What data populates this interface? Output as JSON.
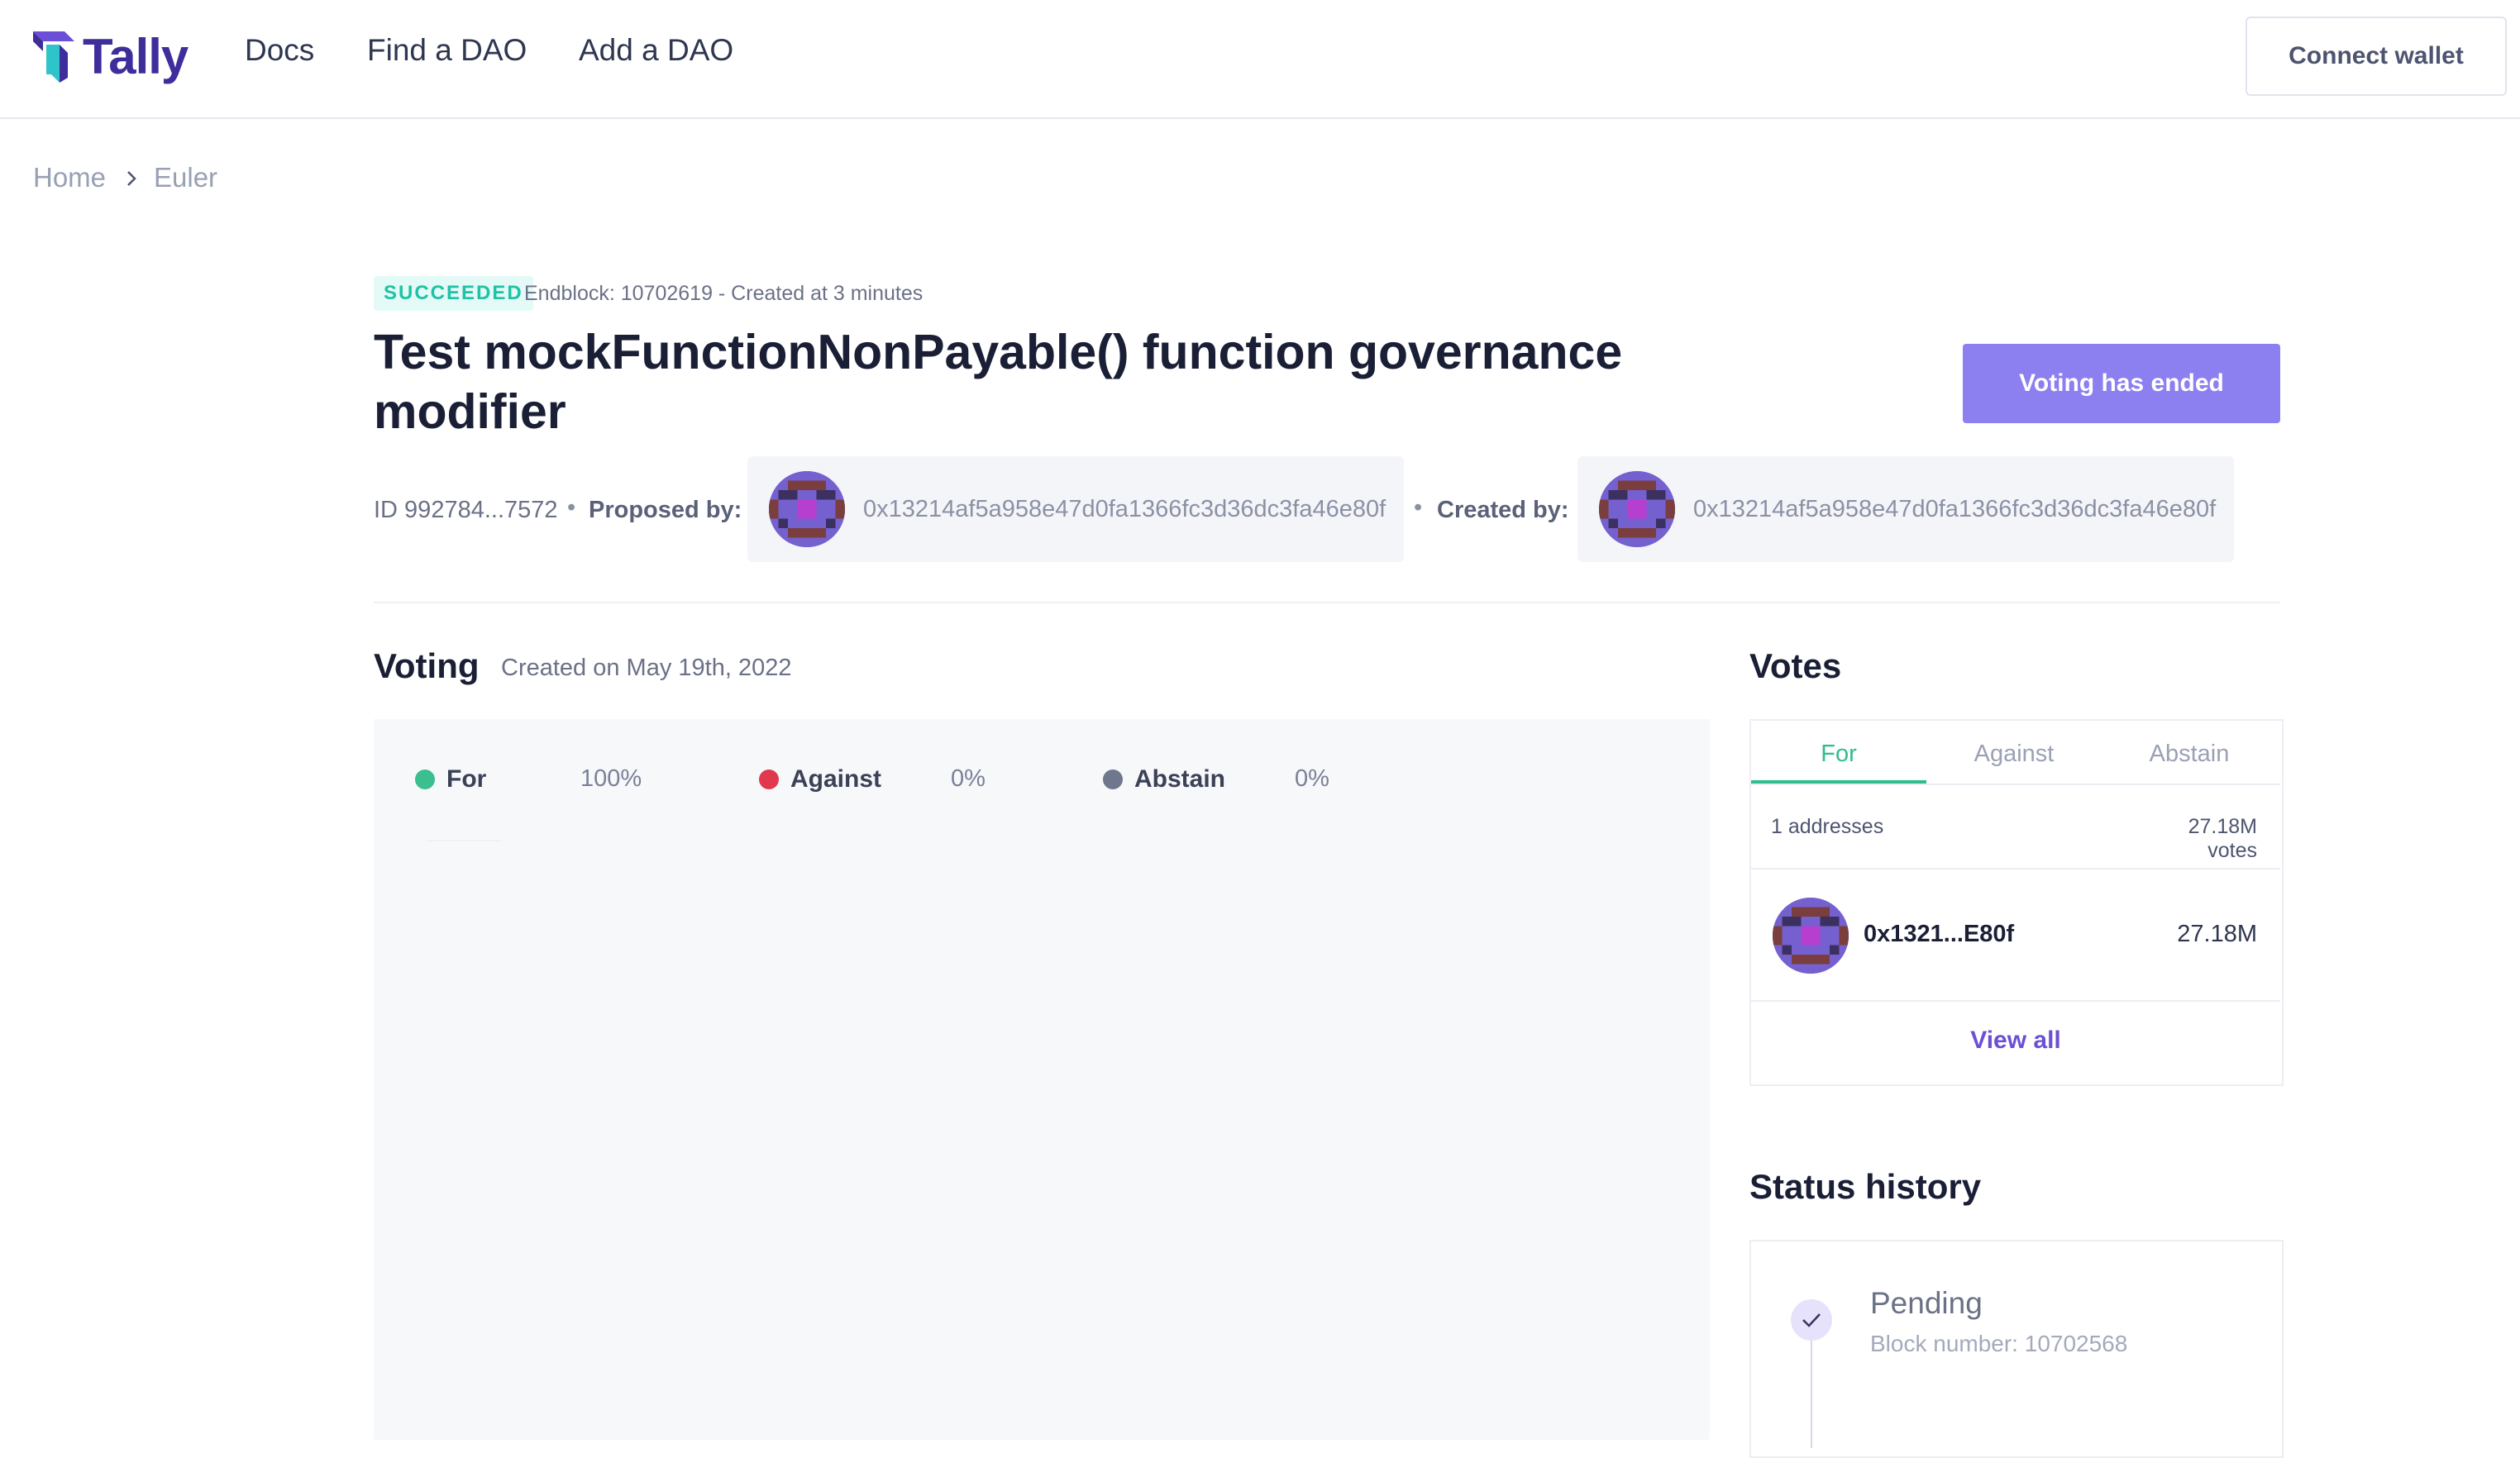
{
  "header": {
    "logo_text": "Tally",
    "nav": [
      "Docs",
      "Find a DAO",
      "Add a DAO"
    ],
    "connect_wallet": "Connect wallet"
  },
  "breadcrumb": {
    "home": "Home",
    "current": "Euler"
  },
  "proposal": {
    "status_badge": "SUCCEEDED",
    "meta": "Endblock: 10702619 - Created at 3 minutes",
    "title": "Test mockFunctionNonPayable() function governance modifier",
    "action_button": "Voting has ended",
    "id": "ID 992784...7572",
    "proposed_by_label": "Proposed by:",
    "proposer_address": "0x13214af5a958e47d0fa1366fc3d36dc3fa46e80f",
    "created_by_label": "Created by:",
    "creator_address": "0x13214af5a958e47d0fa1366fc3d36dc3fa46e80f"
  },
  "voting": {
    "title": "Voting",
    "created_on": "Created on May 19th, 2022",
    "legend": [
      {
        "label": "For",
        "percent": "100%",
        "color": "#3bbf8f"
      },
      {
        "label": "Against",
        "percent": "0%",
        "color": "#e0394f"
      },
      {
        "label": "Abstain",
        "percent": "0%",
        "color": "#6e778c"
      }
    ]
  },
  "votes": {
    "title": "Votes",
    "tabs": [
      "For",
      "Against",
      "Abstain"
    ],
    "active_tab": "For",
    "summary_addresses": "1 addresses",
    "summary_votes": "27.18M votes",
    "voters": [
      {
        "address": "0x1321...E80f",
        "votes": "27.18M"
      }
    ],
    "view_all": "View all"
  },
  "status_history": {
    "title": "Status history",
    "items": [
      {
        "name": "Pending",
        "block": "Block number: 10702568"
      }
    ]
  },
  "colors": {
    "brand": "#3d2e9c",
    "accent_button": "#8c7ff0",
    "for_green": "#3bbf8f",
    "link_purple": "#6b4fd6"
  }
}
